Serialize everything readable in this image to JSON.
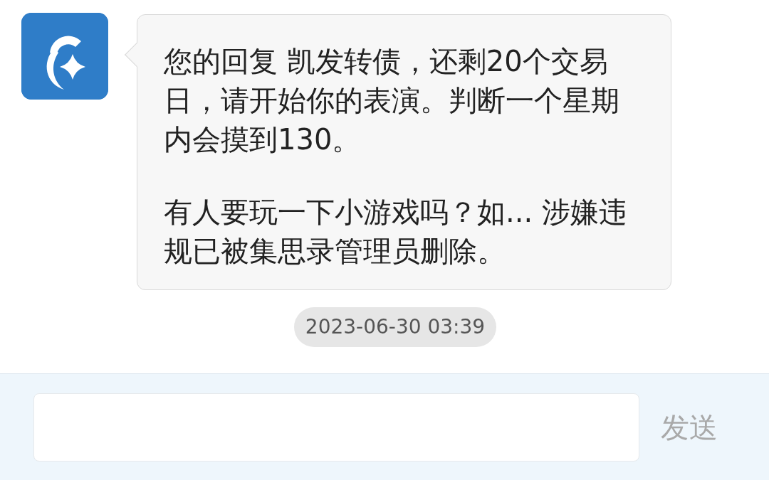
{
  "message": {
    "paragraphs": [
      "您的回复 凯发转债，还剩20个交易日，请开始你的表演。判断一个星期内会摸到130。",
      "有人要玩一下小游戏吗？如... 涉嫌违规已被集思录管理员删除。"
    ]
  },
  "timestamp": "2023-06-30 03:39",
  "composer": {
    "send_label": "发送"
  }
}
